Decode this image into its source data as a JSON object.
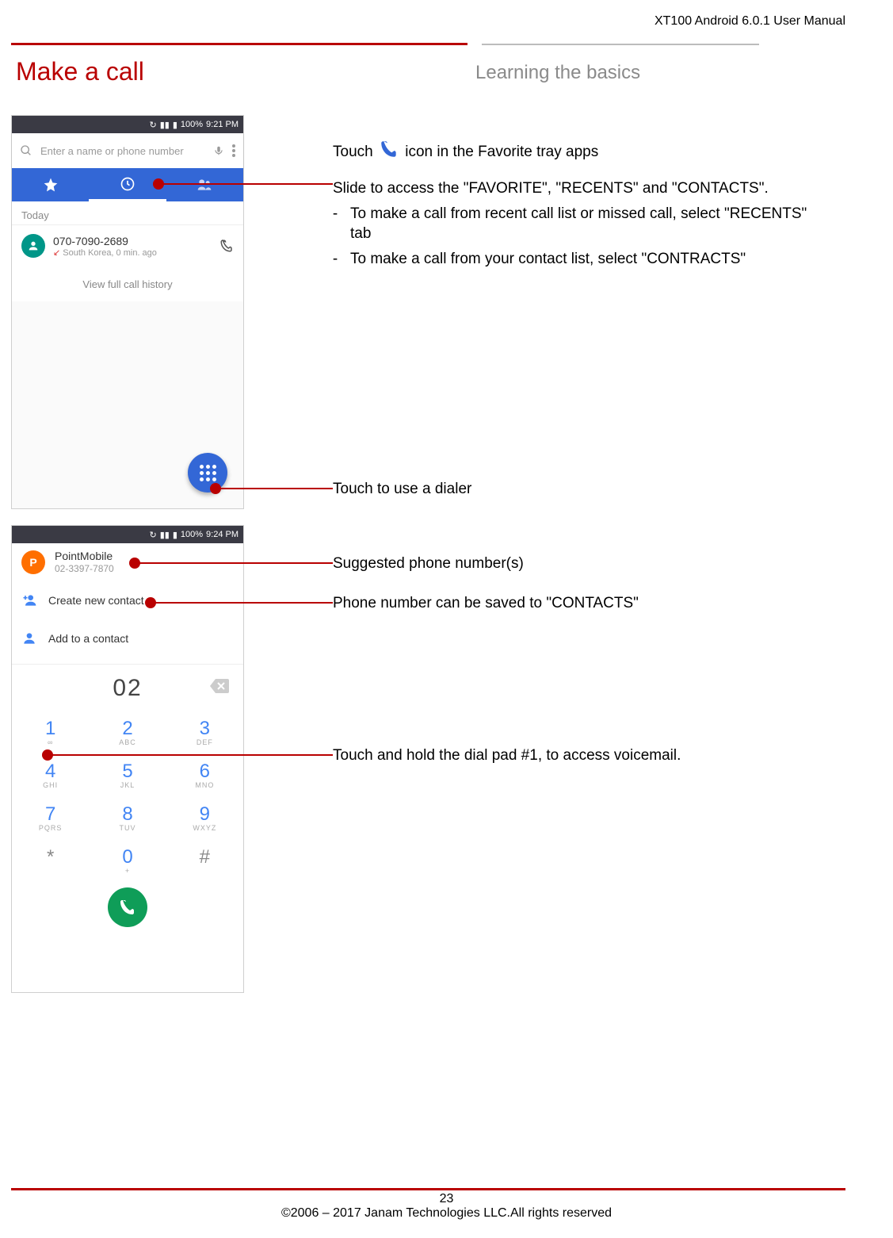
{
  "doc_title": "XT100 Android 6.0.1 User Manual",
  "section_title": "Make a call",
  "subtitle": "Learning the basics",
  "shot1": {
    "status_time": "9:21 PM",
    "status_battery": "100%",
    "search_placeholder": "Enter a name or phone number",
    "today_label": "Today",
    "recent_number": "070-7090-2689",
    "recent_sub": "South Korea, 0 min. ago",
    "full_history": "View full call history"
  },
  "shot2": {
    "status_time": "9:24 PM",
    "status_battery": "100%",
    "sugg_name": "PointMobile",
    "sugg_number": "02-3397-7870",
    "create_contact": "Create new contact",
    "add_contact": "Add to a contact",
    "typed": "02",
    "keys": [
      {
        "d": "1",
        "l": "∞"
      },
      {
        "d": "2",
        "l": "ABC"
      },
      {
        "d": "3",
        "l": "DEF"
      },
      {
        "d": "4",
        "l": "GHI"
      },
      {
        "d": "5",
        "l": "JKL"
      },
      {
        "d": "6",
        "l": "MNO"
      },
      {
        "d": "7",
        "l": "PQRS"
      },
      {
        "d": "8",
        "l": "TUV"
      },
      {
        "d": "9",
        "l": "WXYZ"
      },
      {
        "d": "*",
        "l": ""
      },
      {
        "d": "0",
        "l": "+"
      },
      {
        "d": "#",
        "l": ""
      }
    ]
  },
  "callouts": {
    "touch_pre": "Touch ",
    "touch_post": " icon in the Favorite tray apps",
    "slide": "Slide to access the \"FAVORITE\", \"RECENTS\" and \"CONTACTS\".",
    "bullet1": "To make a call from recent call list or missed call, select \"RECENTS\" tab",
    "bullet2": "To make a call from your contact list, select \"CONTRACTS\"",
    "dialer": "Touch to use a dialer",
    "suggested": "Suggested phone number(s)",
    "save_contacts": "Phone number can be saved to \"CONTACTS\"",
    "voicemail": "Touch and hold the dial pad #1, to access voicemail."
  },
  "footer": {
    "page": "23",
    "copyright": "©2006 – 2017 Janam Technologies LLC.All rights reserved"
  }
}
